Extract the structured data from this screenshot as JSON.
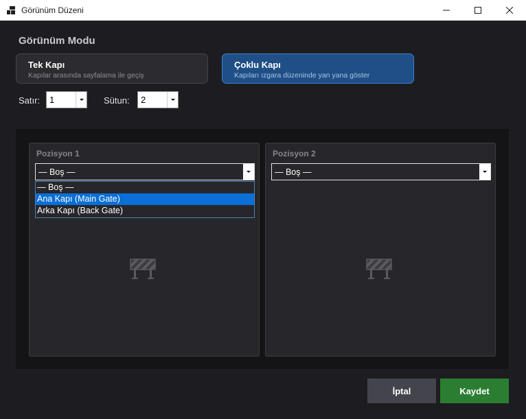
{
  "window": {
    "title": "Görünüm Düzeni",
    "icons": [
      "app-icon",
      "minimize-icon",
      "maximize-icon",
      "close-icon"
    ]
  },
  "view_mode": {
    "heading": "Görünüm Modu",
    "options": [
      {
        "title": "Tek Kapı",
        "subtitle": "Kapılar arasında sayfalama ile geçiş",
        "selected": false
      },
      {
        "title": "Çoklu Kapı",
        "subtitle": "Kapıları ızgara düzeninde yan yana göster",
        "selected": true
      }
    ]
  },
  "grid_size": {
    "rows_label": "Satır:",
    "rows_value": "1",
    "cols_label": "Sütun:",
    "cols_value": "2"
  },
  "positions": [
    {
      "label": "Pozisyon 1",
      "selected": "— Boş —",
      "dropdown_open": true,
      "options": [
        "— Boş —",
        "Ana Kapı (Main Gate)",
        "Arka Kapı (Back Gate)"
      ],
      "highlighted_option": "Ana Kapı (Main Gate)",
      "placeholder_icon": "barrier-icon"
    },
    {
      "label": "Pozisyon 2",
      "selected": "— Boş —",
      "dropdown_open": false,
      "placeholder_icon": "barrier-icon"
    }
  ],
  "footer": {
    "cancel_label": "İptal",
    "save_label": "Kaydet"
  },
  "colors": {
    "background": "#1d1d21",
    "selected_mode": "#1f4f86",
    "selected_mode_border": "#3f82d4",
    "highlight": "#0a6fd6",
    "save_button": "#2b7d31",
    "cancel_button": "#44444c"
  }
}
